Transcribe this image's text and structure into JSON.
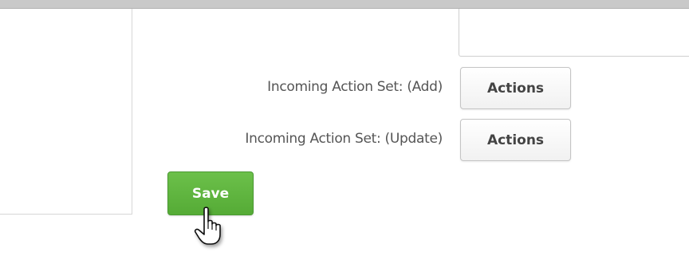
{
  "form": {
    "incoming_add": {
      "label": "Incoming Action Set: (Add)",
      "button_label": "Actions"
    },
    "incoming_update": {
      "label": "Incoming Action Set: (Update)",
      "button_label": "Actions"
    },
    "save_label": "Save"
  },
  "colors": {
    "save_button": "#5cb33c",
    "label_text": "#555555",
    "button_text": "#444444"
  },
  "icons": {
    "cursor": "hand-pointer-cursor-icon"
  }
}
